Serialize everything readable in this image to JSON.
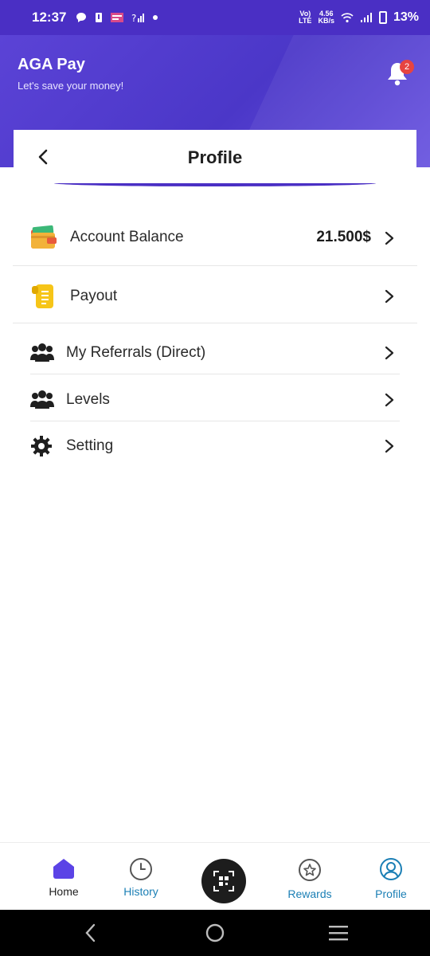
{
  "status_bar": {
    "time": "12:37",
    "network_speed_value": "4.56",
    "network_speed_unit": "KB/s",
    "volte_top": "Vo)",
    "volte_bottom": "LTE",
    "battery": "13%"
  },
  "header": {
    "title": "AGA Pay",
    "subtitle": "Let's save your money!",
    "notification_count": "2"
  },
  "page": {
    "title": "Profile"
  },
  "menu": {
    "account_balance": {
      "label": "Account Balance",
      "value": "21.500$"
    },
    "payout": {
      "label": "Payout"
    },
    "referrals": {
      "label": "My Referrals (Direct)"
    },
    "levels": {
      "label": "Levels"
    },
    "setting": {
      "label": "Setting"
    }
  },
  "bottom_nav": {
    "home": "Home",
    "history": "History",
    "rewards": "Rewards",
    "profile": "Profile"
  },
  "colors": {
    "brand": "#4a2fc4",
    "accent_blue": "#1b7fb5",
    "active_home": "#5b43e6",
    "badge": "#e53935"
  }
}
